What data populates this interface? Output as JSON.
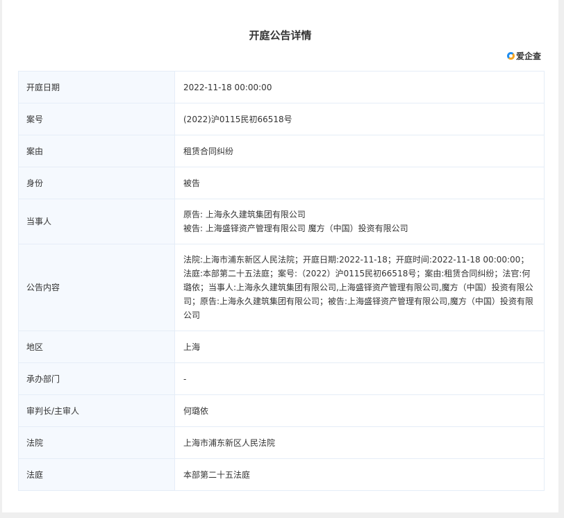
{
  "title": "开庭公告详情",
  "logo_text": "爱企查",
  "rows": [
    {
      "label": "开庭日期",
      "value": "2022-11-18 00:00:00"
    },
    {
      "label": "案号",
      "value": "(2022)沪0115民初66518号"
    },
    {
      "label": "案由",
      "value": "租赁合同纠纷"
    },
    {
      "label": "身份",
      "value": "被告"
    },
    {
      "label": "当事人",
      "lines": [
        "原告: 上海永久建筑集团有限公司",
        "被告: 上海盛铎资产管理有限公司 魔方（中国）投资有限公司"
      ]
    },
    {
      "label": "公告内容",
      "value": "法院:上海市浦东新区人民法院；开庭日期:2022-11-18；开庭时间:2022-11-18 00:00:00；法庭:本部第二十五法庭；案号:（2022）沪0115民初66518号；案由:租赁合同纠纷；法官:何璐依；当事人:上海永久建筑集团有限公司,上海盛铎资产管理有限公司,魔方（中国）投资有限公司；原告:上海永久建筑集团有限公司；被告:上海盛铎资产管理有限公司,魔方（中国）投资有限公司"
    },
    {
      "label": "地区",
      "value": "上海"
    },
    {
      "label": "承办部门",
      "value": "-"
    },
    {
      "label": "审判长/主审人",
      "value": "何璐依"
    },
    {
      "label": "法院",
      "value": "上海市浦东新区人民法院"
    },
    {
      "label": "法庭",
      "value": "本部第二十五法庭"
    }
  ]
}
